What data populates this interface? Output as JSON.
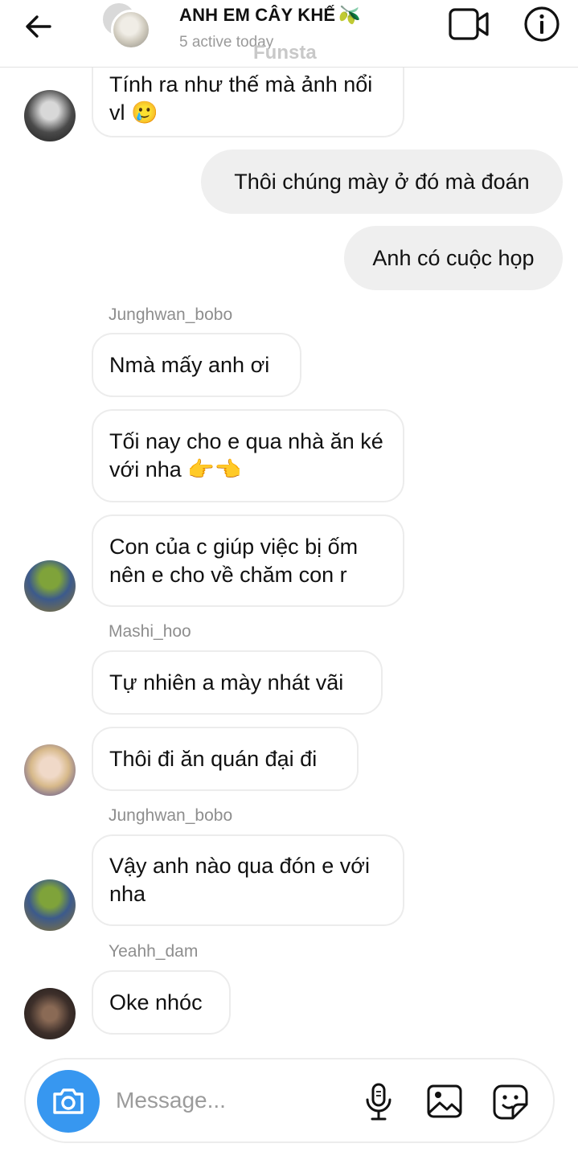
{
  "header": {
    "title": "ANH EM CÂY KHẾ",
    "title_emoji": "🫒",
    "subtitle": "5 active today",
    "watermark": "Funsta"
  },
  "messages": [
    {
      "type": "in",
      "text": "Tính ra như thế mà ảnh nổi vl 🥲",
      "avatar": "dark"
    },
    {
      "type": "out",
      "text": "Thôi chúng mày ở đó mà đoán"
    },
    {
      "type": "out",
      "text": "Anh có cuộc họp"
    },
    {
      "type": "sender",
      "text": "Junghwan_bobo"
    },
    {
      "type": "in",
      "text": "Nmà mấy anh ơi"
    },
    {
      "type": "in",
      "text": "Tối nay cho e qua nhà ăn ké với nha 👉👈"
    },
    {
      "type": "in",
      "text": "Con của c giúp việc bị ốm nên e cho về chăm con r",
      "avatar": "frog"
    },
    {
      "type": "sender",
      "text": "Mashi_hoo"
    },
    {
      "type": "in",
      "text": "Tự nhiên a mày nhát vãi"
    },
    {
      "type": "in",
      "text": "Thôi đi ăn quán đại đi",
      "avatar": "blond"
    },
    {
      "type": "sender",
      "text": "Junghwan_bobo"
    },
    {
      "type": "in",
      "text": "Vậy anh nào qua đón e với nha",
      "avatar": "frog"
    },
    {
      "type": "sender",
      "text": "Yeahh_dam"
    },
    {
      "type": "in",
      "text": "Oke nhóc",
      "avatar": "dam"
    }
  ],
  "composer": {
    "placeholder": "Message..."
  },
  "colors": {
    "accent": "#3797f0",
    "outgoing_bubble": "#efefef",
    "incoming_border": "#ececec"
  },
  "icons": [
    "back-arrow-icon",
    "video-call-icon",
    "info-icon",
    "camera-icon",
    "microphone-icon",
    "gallery-icon",
    "sticker-icon"
  ]
}
